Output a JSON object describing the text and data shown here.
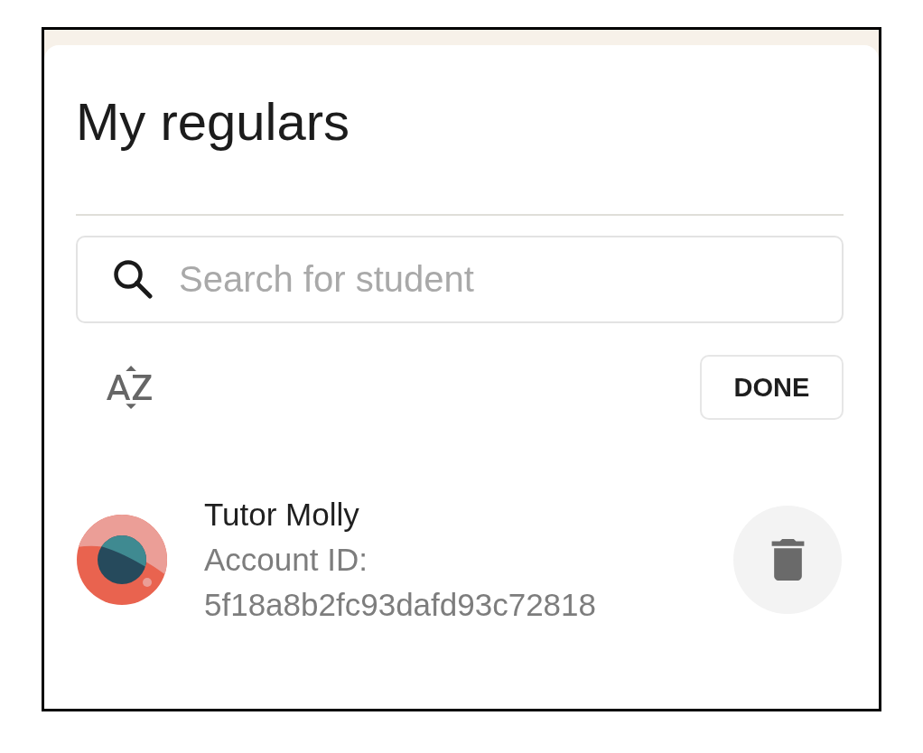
{
  "header": {
    "title": "My regulars"
  },
  "search": {
    "placeholder": "Search for student"
  },
  "toolbar": {
    "done_label": "DONE"
  },
  "students": [
    {
      "name": "Tutor Molly",
      "id_label": "Account ID:",
      "account_id": "5f18a8b2fc93dafd93c72818"
    }
  ]
}
